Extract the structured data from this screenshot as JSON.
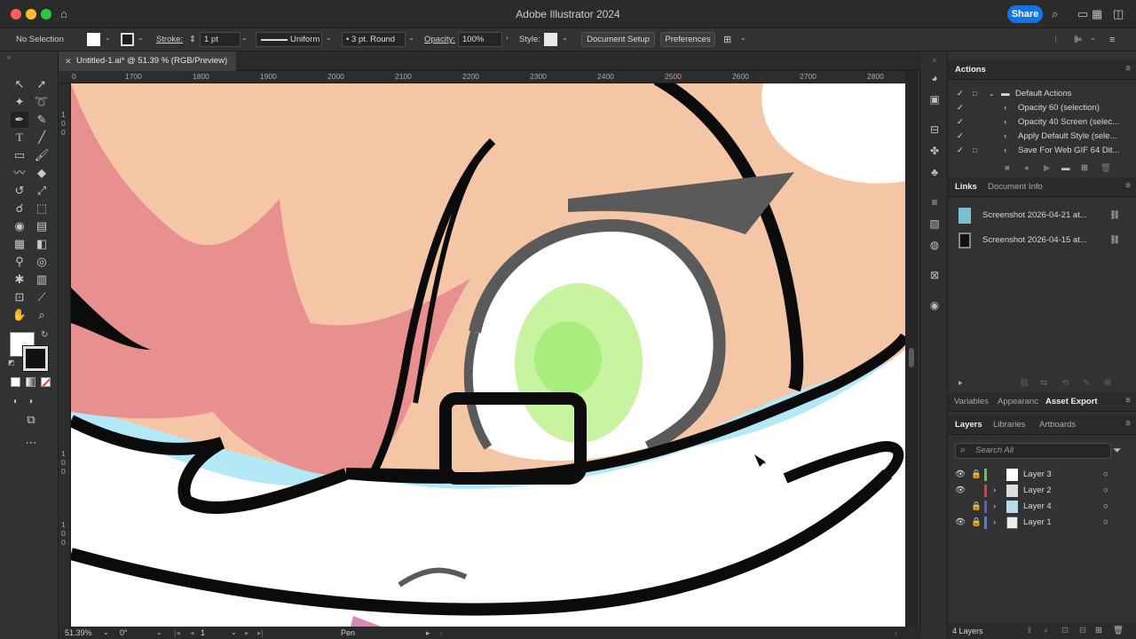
{
  "window": {
    "title": "Adobe Illustrator 2024",
    "share_label": "Share"
  },
  "control_bar": {
    "selection": "No Selection",
    "stroke_label": "Stroke:",
    "stroke_value": "1 pt",
    "profile": "Uniform",
    "brush": "3 pt. Round",
    "opacity_label": "Opacity:",
    "opacity_value": "100%",
    "style_label": "Style:",
    "document_setup": "Document Setup",
    "preferences": "Preferences"
  },
  "document": {
    "tab_title": "Untitled-1.ai* @ 51.39 % (RGB/Preview)",
    "ruler_h": [
      "0",
      "1700",
      "1800",
      "1900",
      "2000",
      "2100",
      "2200",
      "2300",
      "2400",
      "2500",
      "2600",
      "2700",
      "2800"
    ],
    "ruler_v": [
      "1",
      "0",
      "0",
      "1",
      "0",
      "0",
      "1",
      "0",
      "0"
    ]
  },
  "status_bar": {
    "zoom": "51.39%",
    "rotation": "0°",
    "artboard": "1",
    "tool": "Pen"
  },
  "actions_panel": {
    "tab": "Actions",
    "set": "Default Actions",
    "items": [
      "Opacity 60 (selection)",
      "Opacity 40 Screen (selec...",
      "Apply Default Style (sele...",
      "Save For Web GIF 64 Dit..."
    ]
  },
  "links_panel": {
    "tabs": [
      "Links",
      "Document Info"
    ],
    "items": [
      "Screenshot 2026-04-21 at...",
      "Screenshot 2026-04-15 at..."
    ]
  },
  "mid_panel": {
    "tabs": [
      "Variables",
      "Appearanc",
      "Asset Export"
    ]
  },
  "layers_panel": {
    "tabs": [
      "Layers",
      "Libraries",
      "Artboards"
    ],
    "search_placeholder": "Search All",
    "layers": [
      {
        "name": "Layer 3",
        "color": "#4fd14f"
      },
      {
        "name": "Layer 2",
        "color": "#e03c3c"
      },
      {
        "name": "Layer 4",
        "color": "#6a4fd9"
      },
      {
        "name": "Layer 1",
        "color": "#4f7fe0"
      }
    ],
    "count": "4 Layers"
  },
  "colors": {
    "accent": "#1473e6",
    "skin": "#f5c6a5",
    "hair": "#e89090",
    "eye_green": "#b8f08a",
    "sky": "#b3e8f7"
  }
}
